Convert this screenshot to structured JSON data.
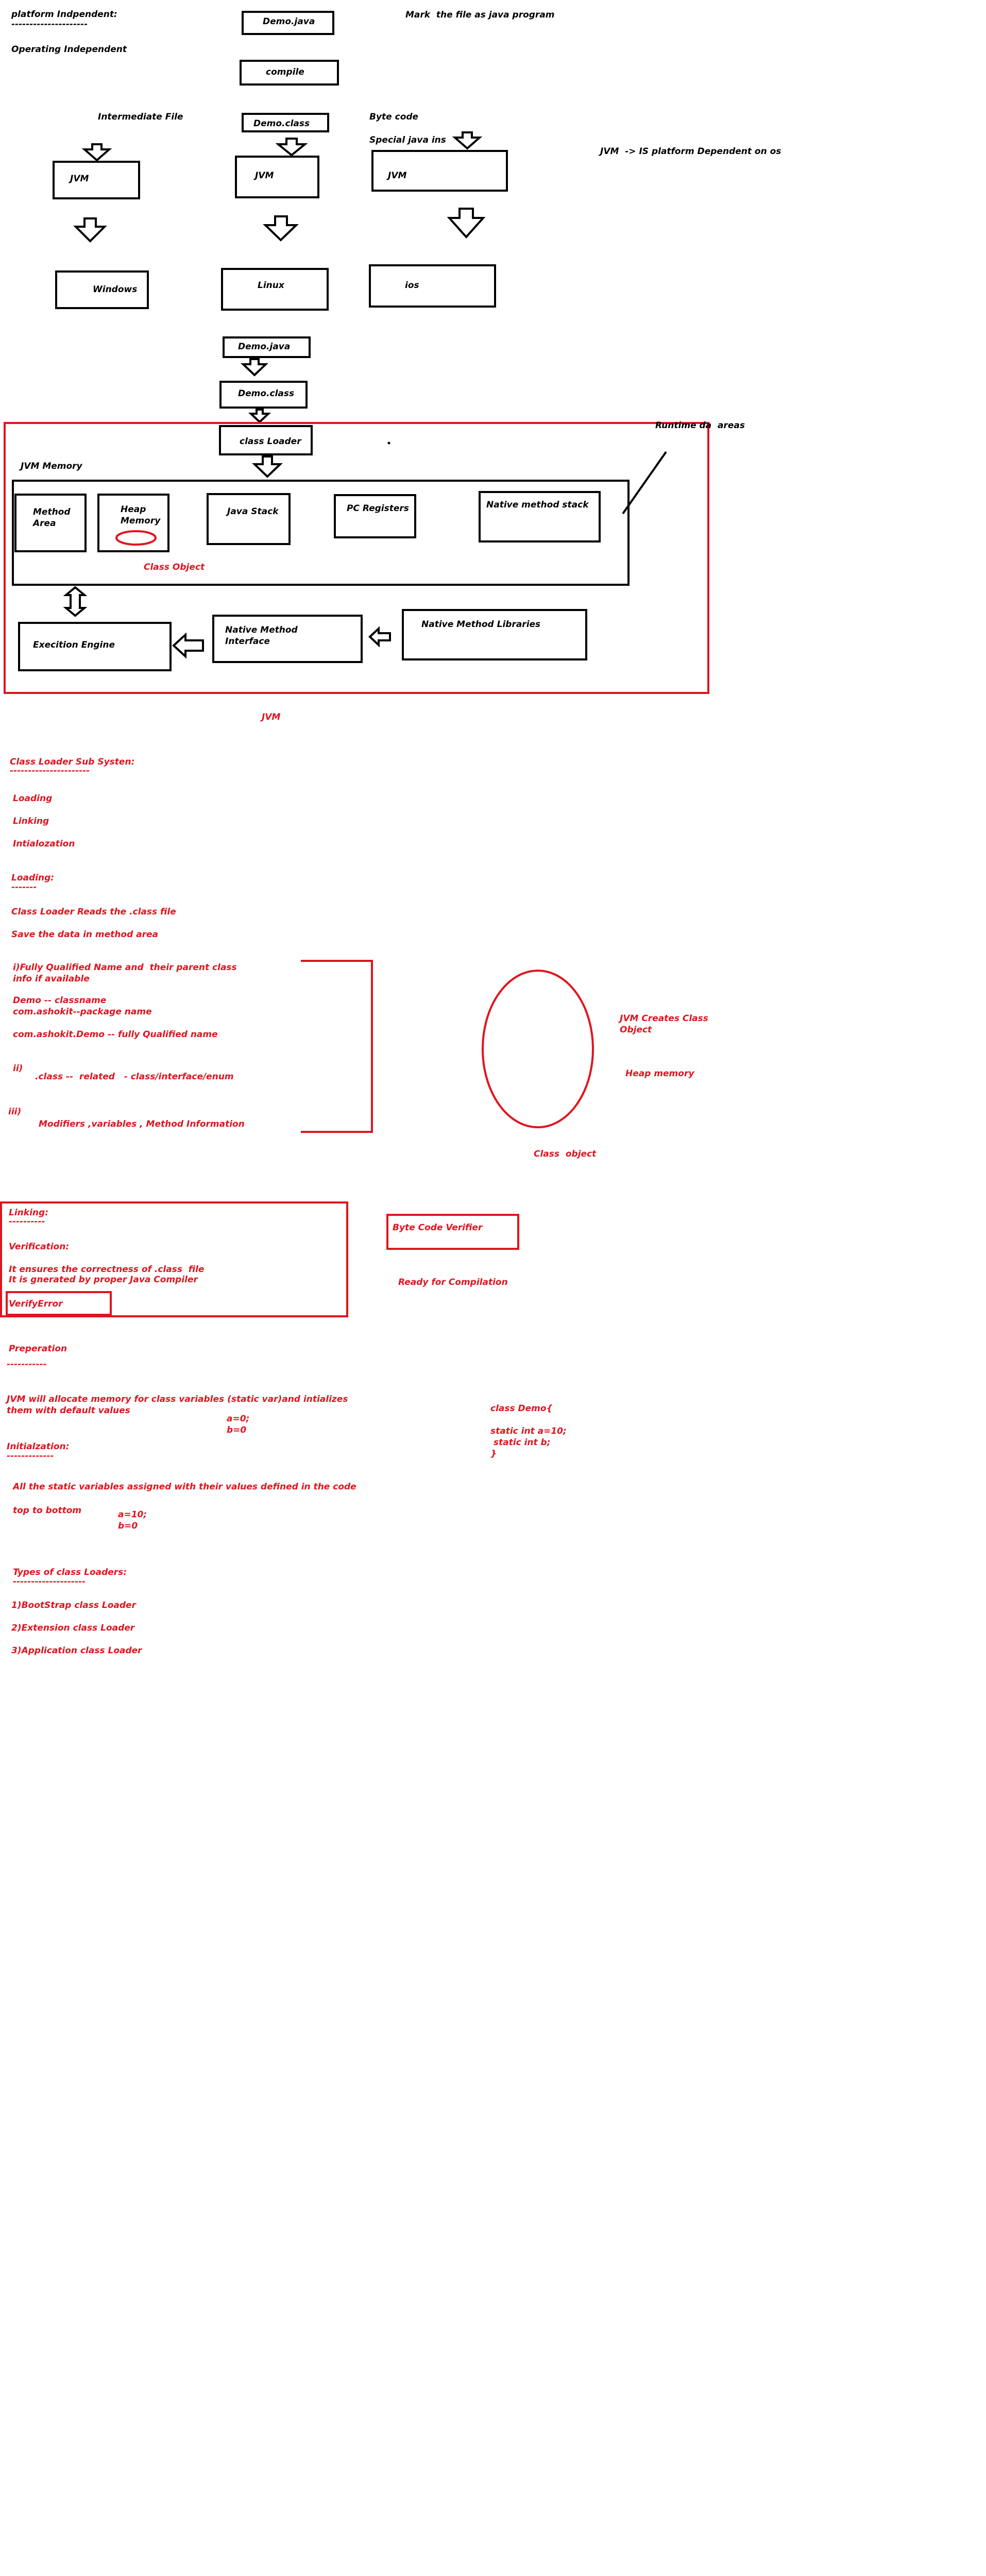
{
  "colors": {
    "ink": "#000000",
    "red": "#e0141e",
    "background": "#ffffff"
  },
  "top": {
    "platform_independent": "platform Indpendent:",
    "platform_underline": "---------------------",
    "operating_independent": "Operating Independent",
    "mark_note": "Mark  the file as java program",
    "demo_java": "Demo.java",
    "compile": "compile",
    "intermediate_file": "Intermediate File",
    "demo_class": "Demo.class",
    "byte_code": "Byte code",
    "special_java_ins": "Special java ins",
    "jvm_note": "JVM  -> IS platform Dependent on os",
    "jvm_left": "JVM",
    "jvm_middle": "JVM",
    "jvm_right": "JVM",
    "windows": "Windows",
    "linux": "Linux",
    "ios": "ios"
  },
  "flow": {
    "demo_java": "Demo.java",
    "demo_class": "Demo.class",
    "class_loader": "class Loader",
    "runtime_data_areas": "Runtime da  areas"
  },
  "jvm_diagram": {
    "jvm_memory": "JVM Memory",
    "method_area": "Method\nArea",
    "heap_memory": "Heap\nMemory",
    "java_stack": "Java Stack",
    "pc_registers": "PC Registers",
    "native_method_stack": "Native method stack",
    "class_object": "Class Object",
    "execution_engine": "Execition Engine",
    "native_method_interface": "Native Method\nInterface",
    "native_method_libraries": "Native Method Libraries",
    "jvm_caption": "JVM"
  },
  "class_loader_subsystem": {
    "title": "Class Loader Sub Systen:",
    "underline": "----------------------",
    "items": [
      "Loading",
      "Linking",
      "Intialozation"
    ]
  },
  "loading": {
    "title": "Loading:",
    "underline": "-------",
    "line1": "Class Loader Reads the .class file",
    "line2": "Save the data in method area",
    "item_i": "i)Fully Qualified Name and  their parent class\ninfo if available",
    "demo_classname": "Demo -- classname",
    "package_name": "com.ashokit--package name",
    "fully_qualified": "com.ashokit.Demo -- fully Qualified name",
    "item_ii_label": "ii)",
    "item_ii_text": ".class --  related   - class/interface/enum",
    "item_iii_label": "iii)",
    "item_iii_text": "Modifiers ,variables , Method Information",
    "jvm_creates": "JVM Creates Class\nObject",
    "heap_memory": "Heap memory",
    "class_object": "Class  object"
  },
  "linking": {
    "title": "Linking:",
    "underline": "----------",
    "verification": "Verification:",
    "line1": "It ensures the correctness of .class  file",
    "line2": "It is gnerated by proper Java Compiler",
    "verify_error": "VerifyError",
    "byte_code_verifier": "Byte Code Verifier",
    "ready": "Ready for Compilation"
  },
  "preparation": {
    "title": "Preperation",
    "underline": "-----------",
    "text": "JVM will allocate memory for class variables (static var)and intializes\nthem with default values",
    "defaults": "a=0;\nb=0",
    "code": "class Demo{\n\nstatic int a=10;\n static int b;\n}"
  },
  "initialization": {
    "title": "Initialzation:",
    "underline": "-------------",
    "line1": "All the static variables assigned with their values defined in the code",
    "line2": "top to bottom",
    "values": "a=10;\nb=0"
  },
  "types": {
    "title": "Types of class Loaders:",
    "underline": "--------------------",
    "items": [
      "1)BootStrap class Loader",
      "2)Extension class Loader",
      "3)Application class Loader"
    ]
  }
}
